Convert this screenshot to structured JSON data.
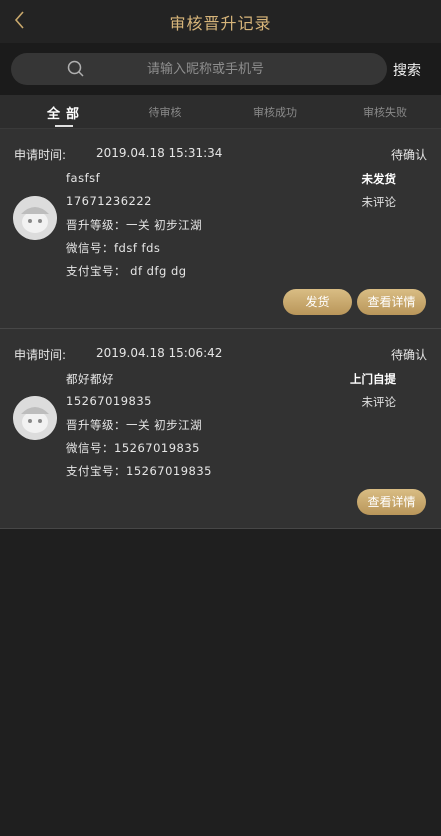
{
  "header": {
    "title": "审核晋升记录"
  },
  "search": {
    "placeholder": "请输入昵称或手机号",
    "button": "搜索"
  },
  "tabs": [
    "全部",
    "待审核",
    "审核成功",
    "审核失败"
  ],
  "records": [
    {
      "label": "申请时间:",
      "time": "2019.04.18 15:31:34",
      "status": "待确认",
      "name": "fasfsf",
      "phone": "17671236222",
      "level": "晋升等级：一关 初步江湖",
      "wechat": "微信号：fdsf fds",
      "alipay": "支付宝号： df dfg dg",
      "ship_state": "未发货",
      "review_state": "未评论",
      "btn_ship": "发货",
      "btn_detail": "查看详情"
    },
    {
      "label": "申请时间:",
      "time": "2019.04.18 15:06:42",
      "status": "待确认",
      "name": "都好都好",
      "phone": "15267019835",
      "level": "晋升等级：一关 初步江湖",
      "wechat": "微信号：15267019835",
      "alipay": "支付宝号：15267019835",
      "ship_state": "上门自提",
      "review_state": "未评论",
      "btn_detail": "查看详情"
    }
  ],
  "colors": {
    "accent": "#d7b57a",
    "button": "#c8a86a",
    "card": "#323232",
    "bg": "#1f1f1f"
  }
}
